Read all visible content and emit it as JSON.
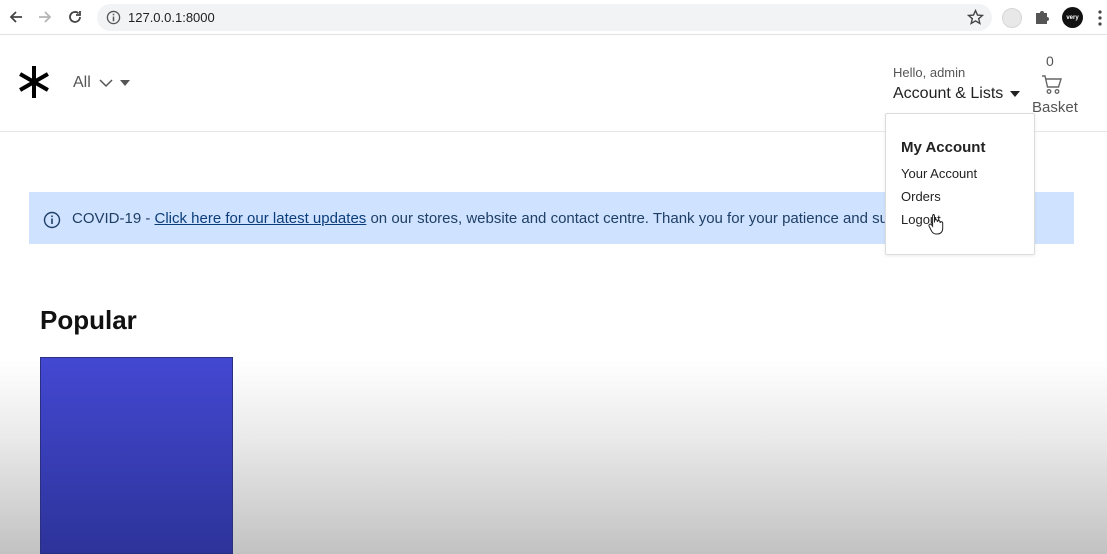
{
  "browser": {
    "url": "127.0.0.1:8000",
    "profile_initial": "very"
  },
  "header": {
    "category_select": "All",
    "greeting": "Hello, admin",
    "account_label": "Account & Lists",
    "basket_count": "0",
    "basket_label": "Basket"
  },
  "alert": {
    "prefix": "COVID-19 - ",
    "link_text": "Click here for our latest updates",
    "suffix": " on our stores, website and contact centre. Thank you for your patience and sup"
  },
  "main": {
    "section_title": "Popular"
  },
  "account_menu": {
    "heading": "My Account",
    "items": [
      {
        "label": "Your Account"
      },
      {
        "label": "Orders"
      },
      {
        "label": "Logout"
      }
    ]
  },
  "colors": {
    "alert_bg": "#cfe2ff",
    "product_blue": "#3b40c2"
  }
}
